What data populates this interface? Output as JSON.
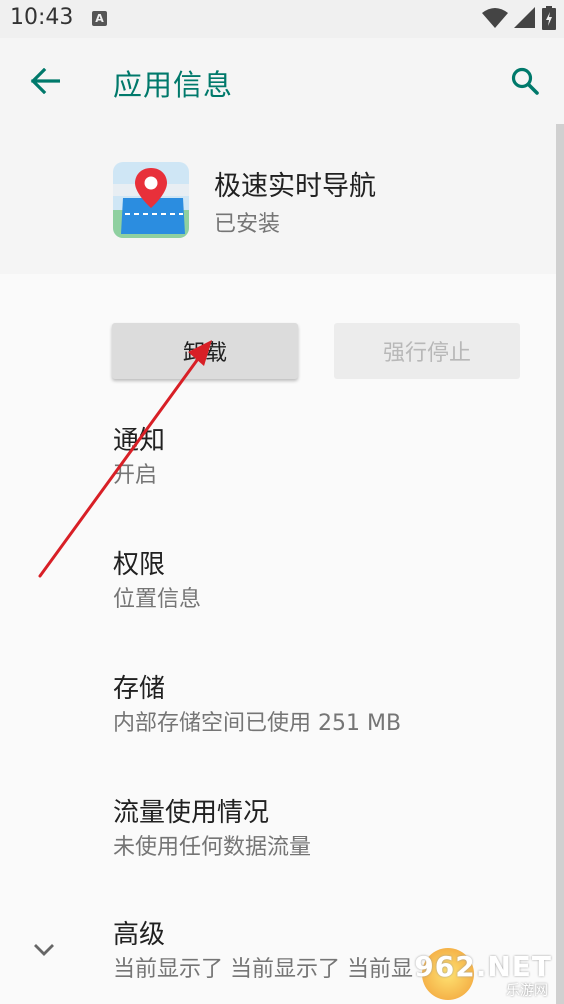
{
  "status_bar": {
    "time": "10:43",
    "notification_icon": "A"
  },
  "app_bar": {
    "title": "应用信息"
  },
  "app": {
    "name": "极速实时导航",
    "status": "已安装"
  },
  "buttons": {
    "uninstall": "卸载",
    "force_stop": "强行停止"
  },
  "items": [
    {
      "title": "通知",
      "subtitle": "开启"
    },
    {
      "title": "权限",
      "subtitle": "位置信息"
    },
    {
      "title": "存储",
      "subtitle": "内部存储空间已使用 251 MB"
    },
    {
      "title": "流量使用情况",
      "subtitle": "未使用任何数据流量"
    },
    {
      "title": "高级",
      "subtitle": "当前显示了 当前显示了 当前显"
    }
  ],
  "watermark": {
    "logo": "962.NET",
    "sub": "乐游网"
  },
  "colors": {
    "accent": "#00796b",
    "arrow": "#d81f26"
  }
}
